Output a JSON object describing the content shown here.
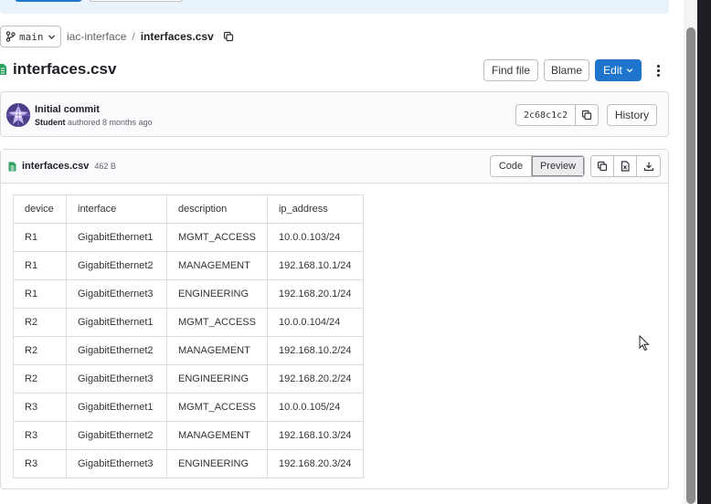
{
  "breadcrumb": {
    "branch": "main",
    "project": "iac-interface",
    "separator": "/",
    "file": "interfaces.csv"
  },
  "file_header": {
    "title": "interfaces.csv",
    "find_file": "Find file",
    "blame": "Blame",
    "edit": "Edit"
  },
  "commit": {
    "title": "Initial commit",
    "author": "Student",
    "meta": "authored 8 months ago",
    "sha": "2c68c1c2",
    "history": "History"
  },
  "viewer": {
    "file_name": "interfaces.csv",
    "file_size": "462 B",
    "code_tab": "Code",
    "preview_tab": "Preview",
    "active_tab": "Preview"
  },
  "table": {
    "headers": [
      "device",
      "interface",
      "description",
      "ip_address"
    ],
    "rows": [
      [
        "R1",
        "GigabitEthernet1",
        "MGMT_ACCESS",
        "10.0.0.103/24"
      ],
      [
        "R1",
        "GigabitEthernet2",
        "MANAGEMENT",
        "192.168.10.1/24"
      ],
      [
        "R1",
        "GigabitEthernet3",
        "ENGINEERING",
        "192.168.20.1/24"
      ],
      [
        "R2",
        "GigabitEthernet1",
        "MGMT_ACCESS",
        "10.0.0.104/24"
      ],
      [
        "R2",
        "GigabitEthernet2",
        "MANAGEMENT",
        "192.168.10.2/24"
      ],
      [
        "R2",
        "GigabitEthernet3",
        "ENGINEERING",
        "192.168.20.2/24"
      ],
      [
        "R3",
        "GigabitEthernet1",
        "MGMT_ACCESS",
        "10.0.0.105/24"
      ],
      [
        "R3",
        "GigabitEthernet2",
        "MANAGEMENT",
        "192.168.10.3/24"
      ],
      [
        "R3",
        "GigabitEthernet3",
        "ENGINEERING",
        "192.168.20.3/24"
      ]
    ]
  },
  "icons": {
    "branch": "branch-icon",
    "chevron": "chevron-down-icon",
    "copy": "copy-icon",
    "file": "csv-file-icon",
    "raw": "raw-file-icon",
    "download": "download-icon",
    "kebab": "more-actions-icon",
    "avatar": "user-avatar"
  },
  "colors": {
    "primary": "#1f75cb",
    "banner": "#e9f3fc",
    "file_icon": "#2da160"
  }
}
